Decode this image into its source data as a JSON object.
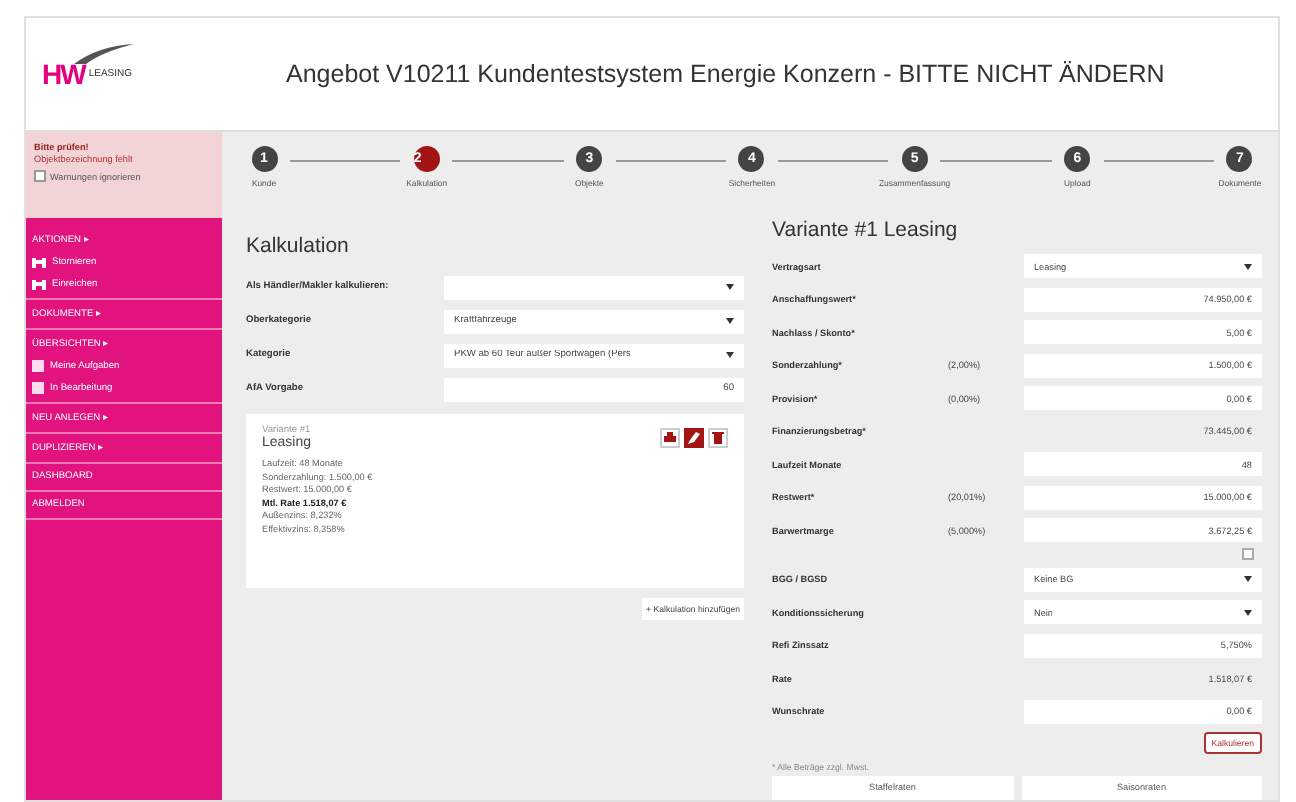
{
  "header": {
    "logo": {
      "mark": "HW",
      "word": "LEASING"
    },
    "title": "Angebot V10211 Kundentestsystem Energie Konzern - BITTE NICHT ÄNDERN"
  },
  "warning": {
    "title": "Bitte prüfen!",
    "message": "Objektbezeichnung fehlt",
    "ignore": {
      "label": "Warnungen ignorieren",
      "checked": false
    }
  },
  "steps": [
    {
      "number": "1",
      "label": "Kunde",
      "selected": false
    },
    {
      "number": "2",
      "label": "Kalkulation",
      "selected": true
    },
    {
      "number": "3",
      "label": "Objekte",
      "selected": false
    },
    {
      "number": "4",
      "label": "Sicherheiten",
      "selected": false
    },
    {
      "number": "5",
      "label": "Zusammenfassung",
      "selected": false
    },
    {
      "number": "6",
      "label": "Upload",
      "selected": false
    },
    {
      "number": "7",
      "label": "Dokumente",
      "selected": false
    }
  ],
  "sidebar": [
    {
      "label": "AKTIONEN ▸",
      "children": [
        {
          "label": "Stornieren",
          "kind": "car"
        },
        {
          "label": "Einreichen",
          "kind": "car"
        }
      ]
    },
    {
      "label": "DOKUMENTE ▸"
    },
    {
      "label": "ÜBERSICHTEN ▸",
      "children": [
        {
          "label": "Meine Aufgaben",
          "kind": "list"
        },
        {
          "label": "In Bearbeitung",
          "kind": "list"
        }
      ]
    },
    {
      "label": "NEU ANLEGEN ▸"
    },
    {
      "label": "DUPLIZIEREN ▸"
    },
    {
      "label": "DASHBOARD"
    },
    {
      "label": "ABMELDEN"
    }
  ],
  "kalkulation": {
    "title": "Kalkulation",
    "fields": [
      {
        "label": "Als Händler/Makler kalkulieren:",
        "kind": "select"
      },
      {
        "label": "Oberkategorie",
        "kind": "select",
        "value": "Kraftfahrzeuge"
      },
      {
        "label": "Kategorie",
        "kind": "select",
        "value": "PKW ab 60 Teur außer Sportwagen (Pers"
      },
      {
        "label": "AfA Vorgabe",
        "kind": "input",
        "value": "60"
      }
    ],
    "variant": {
      "caption": "Variante #1",
      "name": "Leasing",
      "lines": [
        {
          "text": "Laufzeit: 48 Monate",
          "bold": false
        },
        {
          "text": "Sonderzahlung: 1.500,00 €",
          "bold": false
        },
        {
          "text": "Restwert: 15.000,00 €",
          "bold": false
        },
        {
          "text": "Mtl. Rate 1.518,07 €",
          "bold": true
        },
        {
          "text": "Außenzins: 8,232%",
          "bold": false
        },
        {
          "text": "Effektivzins: 8,358%",
          "bold": false
        }
      ],
      "actions": [
        {
          "kind": "print",
          "selected": false
        },
        {
          "kind": "edit",
          "selected": true
        },
        {
          "kind": "delete",
          "selected": false
        }
      ]
    },
    "add_button": "+ Kalkulation hinzufügen"
  },
  "variante": {
    "title": "Variante #1 Leasing",
    "rows": [
      {
        "label": "Vertragsart",
        "kind": "select",
        "value": "Leasing"
      },
      {
        "label": "Anschaffungswert*",
        "kind": "input",
        "value": "74.950,00 €"
      },
      {
        "label": "Nachlass / Skonto*",
        "kind": "input",
        "value": "5,00 €"
      },
      {
        "label": "Sonderzahlung*",
        "percent": "(2,00%)",
        "kind": "input",
        "value": "1.500,00 €"
      },
      {
        "label": "Provision*",
        "percent": "(0,00%)",
        "kind": "input",
        "value": "0,00 €"
      },
      {
        "label": "Finanzierungsbetrag*",
        "kind": "text",
        "value": "73.445,00 €"
      },
      {
        "label": "Laufzeit Monate",
        "kind": "input",
        "value": "48"
      },
      {
        "label": "Restwert*",
        "percent": "(20,01%)",
        "kind": "input",
        "value": "15.000,00 €"
      },
      {
        "label": "Barwertmarge",
        "percent": "(5,000%)",
        "kind": "input",
        "value": "3.672,25 €"
      },
      {
        "kind": "checkbox",
        "checked": false
      },
      {
        "label": "BGG / BGSD",
        "kind": "select",
        "value": "Keine BG"
      },
      {
        "label": "Konditionssicherung",
        "kind": "select",
        "value": "Nein"
      },
      {
        "label": "Refi Zinssatz",
        "kind": "input",
        "value": "5,750%"
      },
      {
        "label": "Rate",
        "kind": "text",
        "value": "1.518,07 €"
      },
      {
        "label": "Wunschrate",
        "kind": "input",
        "value": "0,00 €"
      }
    ],
    "calc_button": "Kalkulieren",
    "note": "* Alle Beträge zzgl. Mwst.",
    "buttons": [
      "Staffelraten",
      "Saisonraten"
    ]
  }
}
